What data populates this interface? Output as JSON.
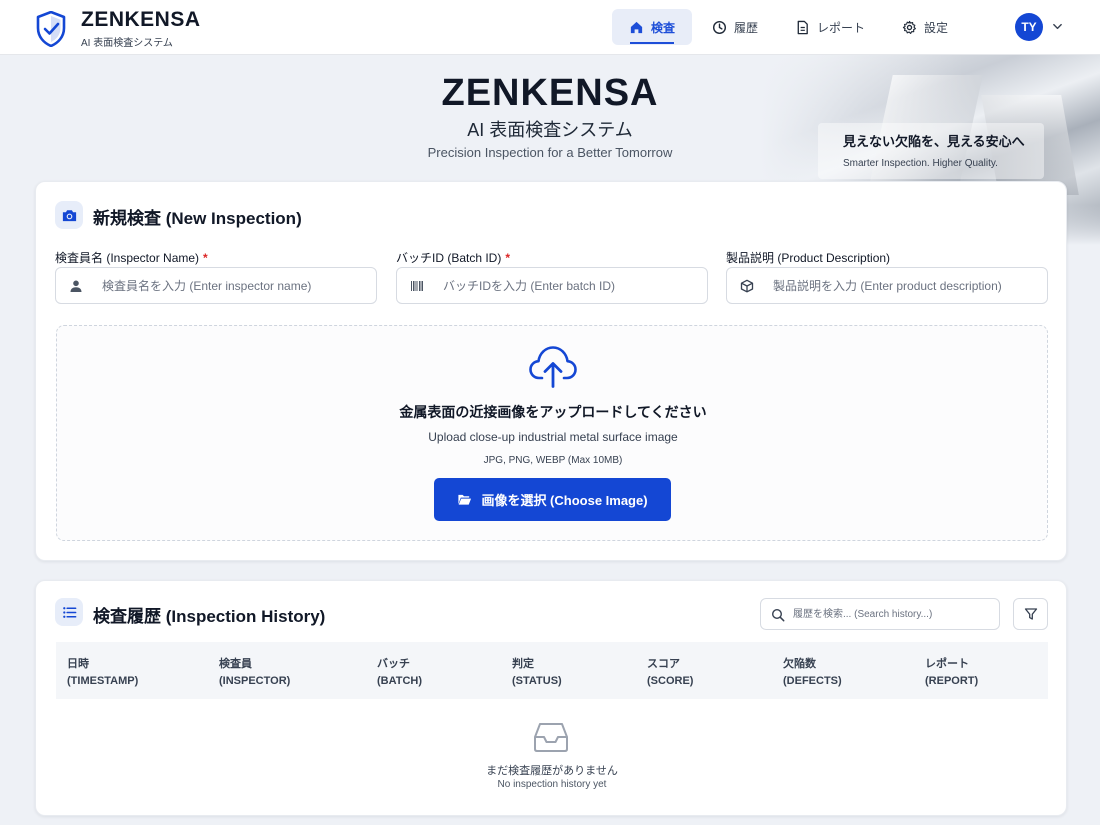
{
  "brand": {
    "name": "ZENKENSA",
    "subtitle": "AI 表面検査システム"
  },
  "nav": {
    "items": [
      {
        "label": "検査",
        "icon": "home-icon",
        "active": true
      },
      {
        "label": "履歴",
        "icon": "clock-icon",
        "active": false
      },
      {
        "label": "レポート",
        "icon": "document-icon",
        "active": false
      },
      {
        "label": "設定",
        "icon": "gear-icon",
        "active": false
      }
    ]
  },
  "user": {
    "initials": "TY"
  },
  "hero": {
    "title": "ZENKENSA",
    "subtitle": "AI 表面検査システム",
    "tagline": "Precision Inspection for a Better Tomorrow",
    "callout_line1": "見えない欠陥を、見える安心へ",
    "callout_line2": "Smarter Inspection. Higher Quality."
  },
  "inspection": {
    "title": "新規検査 (New Inspection)",
    "fields": {
      "inspector": {
        "label": "検査員名 (Inspector Name)",
        "required_mark": "*",
        "placeholder": "検査員名を入力 (Enter inspector name)",
        "value": ""
      },
      "batch": {
        "label": "バッチID (Batch ID)",
        "required_mark": "*",
        "placeholder": "バッチIDを入力 (Enter batch ID)",
        "value": ""
      },
      "product": {
        "label": "製品説明 (Product Description)",
        "placeholder": "製品説明を入力 (Enter product description)",
        "value": ""
      }
    },
    "upload": {
      "title": "金属表面の近接画像をアップロードしてください",
      "subtitle": "Upload close-up industrial metal surface image",
      "formats": "JPG, PNG, WEBP (Max 10MB)",
      "button_label": "画像を選択 (Choose Image)"
    }
  },
  "history": {
    "title": "検査履歴 (Inspection History)",
    "search_placeholder": "履歴を検索... (Search history...)",
    "columns": [
      {
        "ja": "日時",
        "en": "(TIMESTAMP)"
      },
      {
        "ja": "検査員",
        "en": "(INSPECTOR)"
      },
      {
        "ja": "バッチ",
        "en": "(BATCH)"
      },
      {
        "ja": "判定",
        "en": "(STATUS)"
      },
      {
        "ja": "スコア",
        "en": "(SCORE)"
      },
      {
        "ja": "欠陥数",
        "en": "(DEFECTS)"
      },
      {
        "ja": "レポート",
        "en": "(REPORT)"
      }
    ],
    "rows": [],
    "empty_ja": "まだ検査履歴がありません",
    "empty_en": "No inspection history yet"
  },
  "colors": {
    "primary": "#1447d4",
    "required": "#dc2626",
    "background": "#eef1f6"
  }
}
